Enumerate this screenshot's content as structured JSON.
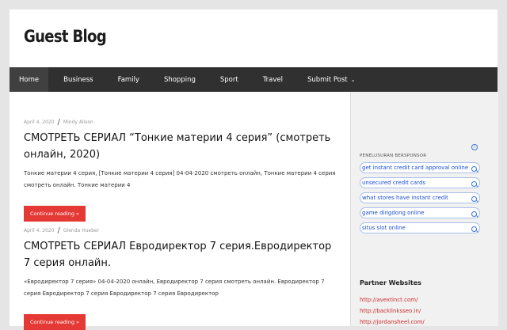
{
  "site": {
    "title": "Guest Blog"
  },
  "nav": {
    "items": [
      "Home",
      "Business",
      "Family",
      "Shopping",
      "Sport",
      "Travel",
      "Submit Post"
    ],
    "submenu_caret": "⌄"
  },
  "posts": [
    {
      "date": "April 4, 2020",
      "author": "Mindy Alison",
      "title": "СМОТРЕТЬ СЕРИАЛ “Тонкие материи 4 серия” (смотреть онлайн, 2020)",
      "excerpt": "Тонкие материи 4 серия, [Тонкие материи 4 серия] 04-04-2020 смотреть онлайн, Тонкие материи 4 серия смотреть онлайн. Тонкие материи 4",
      "button": "Continue reading »"
    },
    {
      "date": "April 4, 2020",
      "author": "Glenda Hueber",
      "title": "СМОТРЕТЬ СЕРИАЛ Евродиректор 7 серия.Евродиректор 7 серия онлайн.",
      "excerpt": "«Евродиректор 7 серия» 04-04-2020 онлайн, Евродиректор 7 серия смотреть онлайн. Евродиректор 7 серия Евродиректор 7 серия Евродиректор 7 серия Евродиректор",
      "button": "Continue reading »"
    }
  ],
  "meta_separator": "/",
  "sidebar": {
    "ads_label": "PENELUSURAN BERSPONSOR",
    "ads_info": "i",
    "ads": [
      "get instant credit card approval online",
      "unsecured credit cards",
      "what stores have instant credit",
      "game dingdong online",
      "situs slot online"
    ],
    "partner_title": "Partner Websites",
    "partners": [
      "http://avextinct.com/",
      "http://backlinksseo.in/",
      "http://jordansheel.com/"
    ]
  },
  "colors": {
    "nav_bg": "#303030",
    "button_red": "#e53935",
    "link_red": "#cc2a2a",
    "ad_blue": "#1a4fd6"
  }
}
